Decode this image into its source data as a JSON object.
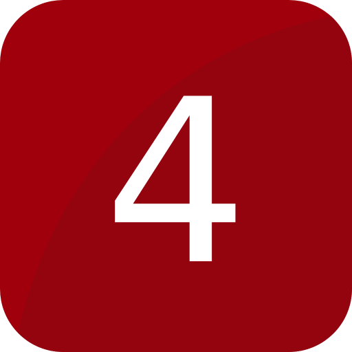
{
  "icon": {
    "digit": "4",
    "colors": {
      "background": "#a0000c",
      "shade": "#93040f",
      "digit": "#ffffff"
    }
  }
}
